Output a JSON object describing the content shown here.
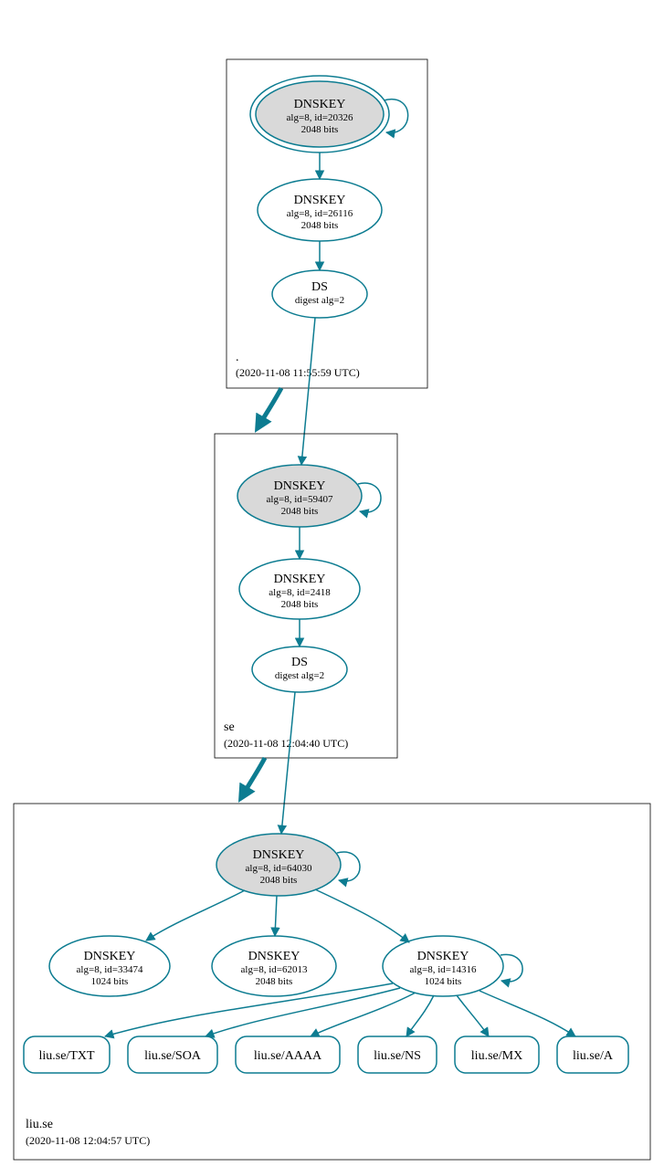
{
  "colors": {
    "teal": "#0d7c91",
    "gray": "#d9d9d9"
  },
  "zones": {
    "root": {
      "label": ".",
      "timestamp": "(2020-11-08 11:55:59 UTC)"
    },
    "se": {
      "label": "se",
      "timestamp": "(2020-11-08 12:04:40 UTC)"
    },
    "liu": {
      "label": "liu.se",
      "timestamp": "(2020-11-08 12:04:57 UTC)"
    }
  },
  "nodes": {
    "root_ksk": {
      "title": "DNSKEY",
      "l1": "alg=8, id=20326",
      "l2": "2048 bits"
    },
    "root_zsk": {
      "title": "DNSKEY",
      "l1": "alg=8, id=26116",
      "l2": "2048 bits"
    },
    "root_ds": {
      "title": "DS",
      "l1": "digest alg=2",
      "l2": ""
    },
    "se_ksk": {
      "title": "DNSKEY",
      "l1": "alg=8, id=59407",
      "l2": "2048 bits"
    },
    "se_zsk": {
      "title": "DNSKEY",
      "l1": "alg=8, id=2418",
      "l2": "2048 bits"
    },
    "se_ds": {
      "title": "DS",
      "l1": "digest alg=2",
      "l2": ""
    },
    "liu_ksk": {
      "title": "DNSKEY",
      "l1": "alg=8, id=64030",
      "l2": "2048 bits"
    },
    "liu_k1": {
      "title": "DNSKEY",
      "l1": "alg=8, id=33474",
      "l2": "1024 bits"
    },
    "liu_k2": {
      "title": "DNSKEY",
      "l1": "alg=8, id=62013",
      "l2": "2048 bits"
    },
    "liu_k3": {
      "title": "DNSKEY",
      "l1": "alg=8, id=14316",
      "l2": "1024 bits"
    }
  },
  "records": {
    "txt": "liu.se/TXT",
    "soa": "liu.se/SOA",
    "aaaa": "liu.se/AAAA",
    "ns": "liu.se/NS",
    "mx": "liu.se/MX",
    "a": "liu.se/A"
  }
}
